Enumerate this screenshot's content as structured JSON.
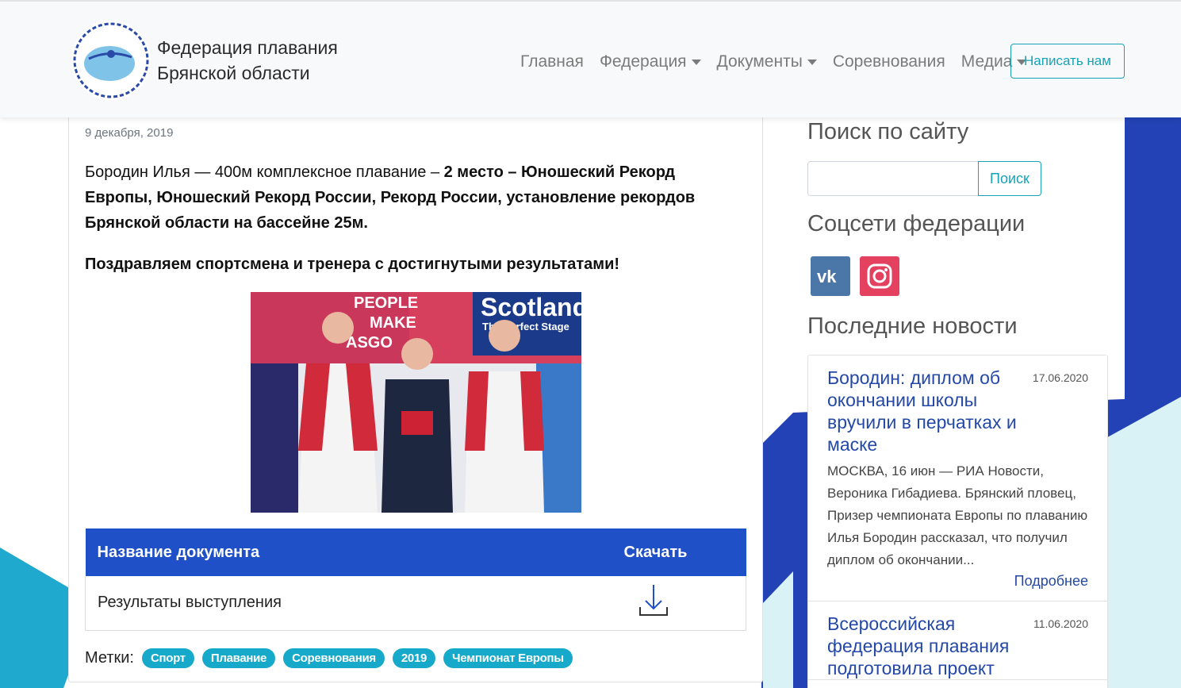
{
  "brand": {
    "line1": "Федерация плавания",
    "line2": "Брянской области",
    "logo_name": "logo-icon"
  },
  "nav": {
    "items": [
      {
        "label": "Главная",
        "dropdown": false
      },
      {
        "label": "Федерация",
        "dropdown": true
      },
      {
        "label": "Документы",
        "dropdown": true
      },
      {
        "label": "Соревнования",
        "dropdown": false
      },
      {
        "label": "Медиа",
        "dropdown": true
      }
    ],
    "contact_label": "Написать нам"
  },
  "article": {
    "date": "9 декабря, 2019",
    "para1_plain": "Бородин Илья — 400м комплексное плавание – ",
    "para1_bold": "2 место – Юношеский Рекорд Европы, Юношеский Рекорд России, Рекорд России, установление рекордов Брянской области на бассейне 25м.",
    "para2": "Поздравляем спортсмена и тренера с достигнутыми результатами!",
    "photo_texts": [
      "PEOPLE",
      "MAKE",
      "ASGO",
      "Scotland",
      "The Perfect Stage"
    ],
    "docs": {
      "col_name": "Название документа",
      "col_download": "Скачать",
      "rows": [
        {
          "name": "Результаты выступления"
        }
      ]
    },
    "tags_label": "Метки:",
    "tags": [
      "Спорт",
      "Плавание",
      "Соревнования",
      "2019",
      "Чемпионат Европы"
    ]
  },
  "sidebar": {
    "search_heading": "Поиск по сайту",
    "search_button": "Поиск",
    "search_value": "",
    "social_heading": "Соцсети федерации",
    "news_heading": "Последние новости",
    "news": [
      {
        "title": "Бородин: диплом об окончании школы вручили в перчатках и маске",
        "date": "17.06.2020",
        "text": "МОСКВА, 16 июн — РИА Новости, Вероника Гибадиева. Брянский пловец, Призер чемпионата Европы по плаванию Илья Бородин рассказал, что получил диплом об окончании...",
        "more": "Подробнее"
      },
      {
        "title": "Всероссийская федерация плавания подготовила проект",
        "date": "11.06.2020",
        "text": "",
        "more": ""
      }
    ]
  },
  "colors": {
    "accent": "#17a2b8",
    "table_header": "#1f50c8",
    "tag": "#17a9c9",
    "news_link": "#2448a8",
    "vk": "#4a76a8",
    "instagram": "#e4405f"
  }
}
